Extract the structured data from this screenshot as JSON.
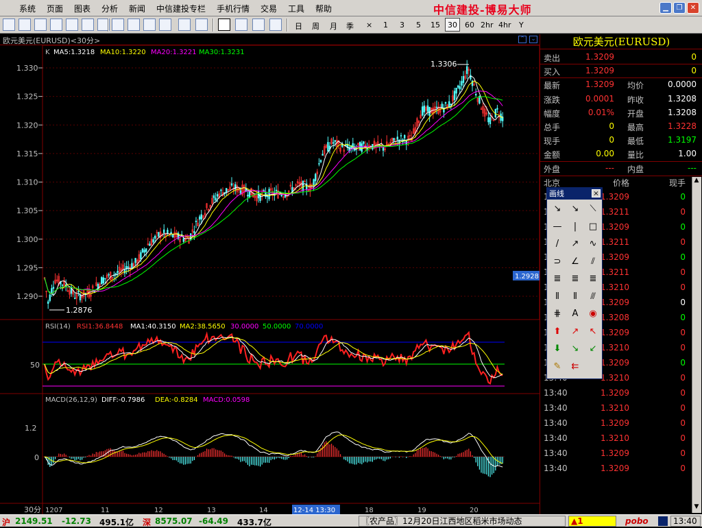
{
  "menu": {
    "items": [
      "系统",
      "页面",
      "图表",
      "分析",
      "新闻",
      "中信建投专栏",
      "手机行情",
      "交易",
      "工具",
      "帮助"
    ],
    "brand": "中信建投-博易大师"
  },
  "toolbar": {
    "periods": [
      "日",
      "周",
      "月",
      "季",
      "×",
      "1",
      "3",
      "5",
      "15",
      "30",
      "60",
      "2hr",
      "4hr",
      "Y"
    ],
    "active_period": "30"
  },
  "chart": {
    "header": "欧元美元(EURUSD)<30分>",
    "ma_line": {
      "k": "K",
      "ma5": "MA5:1.3218",
      "ma10": "MA10:1.3220",
      "ma20": "MA20:1.3221",
      "ma30": "MA30:1.3231"
    },
    "y_ticks": [
      "1.330",
      "1.325",
      "1.320",
      "1.315",
      "1.310",
      "1.305",
      "1.300",
      "1.295",
      "1.290"
    ],
    "high_label": "1.3306",
    "low_label": "1.2876",
    "cursor_price": "1.2928",
    "rsi": {
      "title": "RSI(14)",
      "rsi1": "RSI1:36.8448",
      "ma1": "MA1:40.3150",
      "ma2": "MA2:38.5650",
      "l30": "30.0000",
      "l50": "50.0000",
      "l70": "70.0000",
      "tick": "50"
    },
    "macd": {
      "title": "MACD(26,12,9)",
      "diff": "DIFF:-0.7986",
      "dea": "DEA:-0.8284",
      "macd": "MACD:0.0598",
      "tick_hi": "1.2",
      "tick_zero": "0"
    },
    "x_axis": {
      "period_label": "30分",
      "labels": [
        "1207",
        "11",
        "12",
        "13",
        "14",
        "12-14 13:30",
        "18",
        "19",
        "20"
      ]
    },
    "colors": {
      "up": "#ff3232",
      "down": "#54fcfc",
      "ma5": "#ffffff",
      "ma10": "#ffff00",
      "ma20": "#ff00ff",
      "ma30": "#00ff00"
    }
  },
  "quote": {
    "title": "欧元美元(EURUSD)",
    "rows": [
      {
        "l1": "卖出",
        "v1": "1.3209",
        "c1": "#ff3232",
        "v2": "0",
        "c2": "#ffff00"
      },
      {
        "l1": "买入",
        "v1": "1.3209",
        "c1": "#ff3232",
        "v2": "0",
        "c2": "#ffff00"
      },
      {
        "l1": "最新",
        "v1": "1.3209",
        "c1": "#ff3232",
        "l2": "均价",
        "v2": "0.0000",
        "c2": "#ffffff"
      },
      {
        "l1": "涨跌",
        "v1": "0.0001",
        "c1": "#ff3232",
        "l2": "昨收",
        "v2": "1.3208",
        "c2": "#ffffff"
      },
      {
        "l1": "幅度",
        "v1": "0.01%",
        "c1": "#ff3232",
        "l2": "开盘",
        "v2": "1.3208",
        "c2": "#ffffff"
      },
      {
        "l1": "总手",
        "v1": "0",
        "c1": "#ffff00",
        "l2": "最高",
        "v2": "1.3228",
        "c2": "#ff3232"
      },
      {
        "l1": "现手",
        "v1": "0",
        "c1": "#ffff00",
        "l2": "最低",
        "v2": "1.3197",
        "c2": "#00ff00"
      },
      {
        "l1": "金额",
        "v1": "0.00",
        "c1": "#ffff00",
        "l2": "量比",
        "v2": "1.00",
        "c2": "#ffffff"
      },
      {
        "l1": "外盘",
        "v1": "---",
        "c1": "#ff3232",
        "l2": "内盘",
        "v2": "---",
        "c2": "#00ff00"
      }
    ],
    "ticks_header": {
      "time": "北京",
      "price": "价格",
      "vol": "现手"
    },
    "ticks": [
      {
        "time": "13:40",
        "price": "1.3209",
        "vol": "0",
        "vc": "#00ff00"
      },
      {
        "time": "13:40",
        "price": "1.3211",
        "vol": "0",
        "vc": "#ff3232"
      },
      {
        "time": "13:40",
        "price": "1.3209",
        "vol": "0",
        "vc": "#00ff00"
      },
      {
        "time": "13:40",
        "price": "1.3211",
        "vol": "0",
        "vc": "#ff3232"
      },
      {
        "time": "13:40",
        "price": "1.3209",
        "vol": "0",
        "vc": "#00ff00"
      },
      {
        "time": "13:40",
        "price": "1.3211",
        "vol": "0",
        "vc": "#ff3232"
      },
      {
        "time": "13:40",
        "price": "1.3210",
        "vol": "0",
        "vc": "#ff3232"
      },
      {
        "time": "13:40",
        "price": "1.3209",
        "vol": "0",
        "vc": "#ffffff"
      },
      {
        "time": "13:40",
        "price": "1.3208",
        "vol": "0",
        "vc": "#00ff00"
      },
      {
        "time": "13:40",
        "price": "1.3209",
        "vol": "0",
        "vc": "#ff3232"
      },
      {
        "time": "13:40",
        "price": "1.3210",
        "vol": "0",
        "vc": "#ff3232"
      },
      {
        "time": "13:40",
        "price": "1.3209",
        "vol": "0",
        "vc": "#00ff00"
      },
      {
        "time": "13:40",
        "price": "1.3210",
        "vol": "0",
        "vc": "#ff3232"
      },
      {
        "time": "13:40",
        "price": "1.3209",
        "vol": "0",
        "vc": "#ff3232"
      },
      {
        "time": "13:40",
        "price": "1.3210",
        "vol": "0",
        "vc": "#ff3232"
      },
      {
        "time": "13:40",
        "price": "1.3209",
        "vol": "0",
        "vc": "#ff3232"
      },
      {
        "time": "13:40",
        "price": "1.3210",
        "vol": "0",
        "vc": "#ff3232"
      },
      {
        "time": "13:40",
        "price": "1.3209",
        "vol": "0",
        "vc": "#ff3232"
      },
      {
        "time": "13:40",
        "price": "1.3209",
        "vol": "0",
        "vc": "#ff3232"
      }
    ]
  },
  "draw_palette": {
    "title": "画线",
    "close": "×",
    "tools": [
      "↘",
      "↘",
      "⟍",
      "—",
      "|",
      "□",
      "/",
      "↗",
      "∿",
      "⊃",
      "∠",
      "⫽",
      "≣",
      "≣",
      "≣",
      "⦀",
      "⦀",
      "⫻",
      "⋕",
      "A",
      "◉",
      "⬆",
      "↗",
      "↖",
      "⬇",
      "↘",
      "↙",
      "✎",
      "⇇"
    ],
    "tool_colors": [
      "#000",
      "#000",
      "#000",
      "#000",
      "#000",
      "#000",
      "#000",
      "#000",
      "#000",
      "#000",
      "#000",
      "#000",
      "#000",
      "#000",
      "#000",
      "#000",
      "#000",
      "#000",
      "#000",
      "#000",
      "#c00",
      "#d00",
      "#d00",
      "#d00",
      "#080",
      "#080",
      "#080",
      "#a70",
      "#c00"
    ]
  },
  "status": {
    "sh_label": "沪",
    "sh_idx": "2149.51",
    "sh_chg": "-12.73",
    "sh_amt": "495.1亿",
    "sz_label": "深",
    "sz_idx": "8575.07",
    "sz_chg": "-64.49",
    "sz_amt": "433.7亿",
    "news": "〖农产品〗12月20日江西地区稻米市场动态",
    "alert": "▲1",
    "app": "pobo",
    "time": "13:40"
  }
}
